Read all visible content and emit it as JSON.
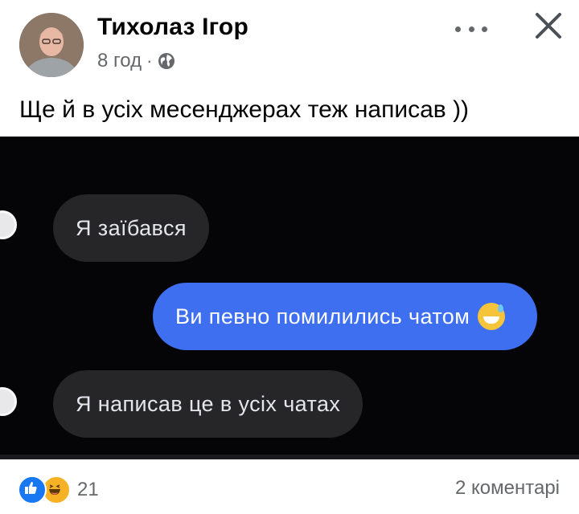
{
  "post": {
    "author": "Тихолаз Ігор",
    "time": "8 год",
    "separator": "·",
    "audience_icon": "globe-icon",
    "text": "Ще й в усіх месенджерах теж написав ))"
  },
  "header_actions": {
    "more_icon": "more-options-icon",
    "close_icon": "close-icon"
  },
  "screenshot": {
    "messages": [
      {
        "direction": "incoming",
        "text": "Я заїбався"
      },
      {
        "direction": "outgoing",
        "text": "Ви певно помилились чатом",
        "emoji": "grinning-sweat-emoji"
      },
      {
        "direction": "incoming",
        "text": "Я написав це в усіх чатах"
      }
    ]
  },
  "footer": {
    "reactions": [
      "like-icon",
      "haha-icon"
    ],
    "reaction_count": "21",
    "comments": "2 коментарі"
  },
  "colors": {
    "outgoing_bubble": "#3d6ff0",
    "incoming_bubble": "#262628",
    "secondary_text": "#65676b"
  }
}
